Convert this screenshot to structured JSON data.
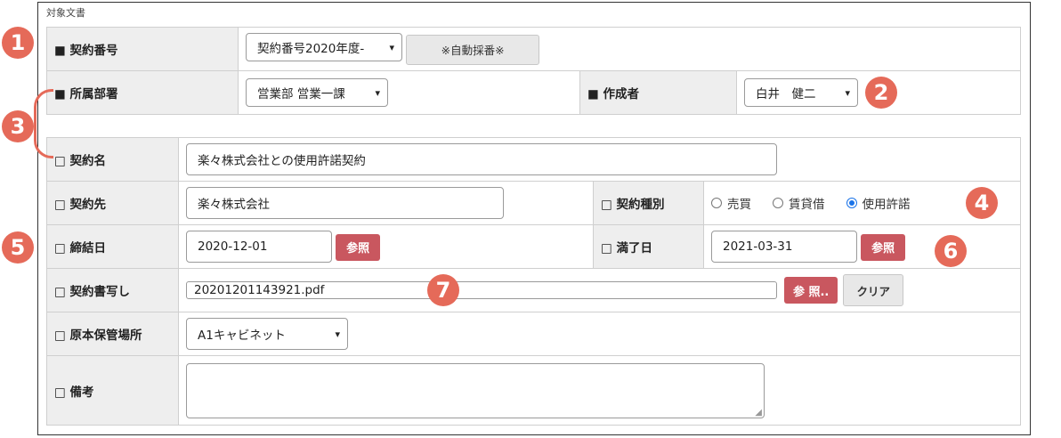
{
  "section_title": "対象文書",
  "row1": {
    "label": "■ 契約番号",
    "select_value": "契約番号2020年度-",
    "auto_button": "※自動採番※"
  },
  "row2": {
    "dept_label": "■ 所属部署",
    "dept_value": "営業部 営業一課",
    "author_label": "■ 作成者",
    "author_value": "白井　健二"
  },
  "contract_name": {
    "label": "□ 契約名",
    "value": "楽々株式会社との使用許諾契約"
  },
  "counterparty": {
    "label": "□ 契約先",
    "value": "楽々株式会社"
  },
  "contract_type": {
    "label": "□ 契約種別",
    "options": [
      "売買",
      "賃貸借",
      "使用許諾"
    ],
    "selected": "使用許諾"
  },
  "conclusion_date": {
    "label": "□ 締結日",
    "value": "2020-12-01",
    "ref_button": "参照"
  },
  "expiry_date": {
    "label": "□ 満了日",
    "value": "2021-03-31",
    "ref_button": "参照"
  },
  "contract_copy": {
    "label": "□ 契約書写し",
    "file": "20201201143921.pdf",
    "browse_button": "参 照..",
    "clear_button": "クリア"
  },
  "storage": {
    "label": "□ 原本保管場所",
    "value": "A1キャビネット"
  },
  "remarks": {
    "label": "□ 備考",
    "value": ""
  },
  "callouts": [
    "1",
    "2",
    "3",
    "4",
    "5",
    "6",
    "7"
  ],
  "colors": {
    "callout": "#e56a59",
    "ref_button": "#c9575f",
    "label_bg": "#eeeeee"
  }
}
